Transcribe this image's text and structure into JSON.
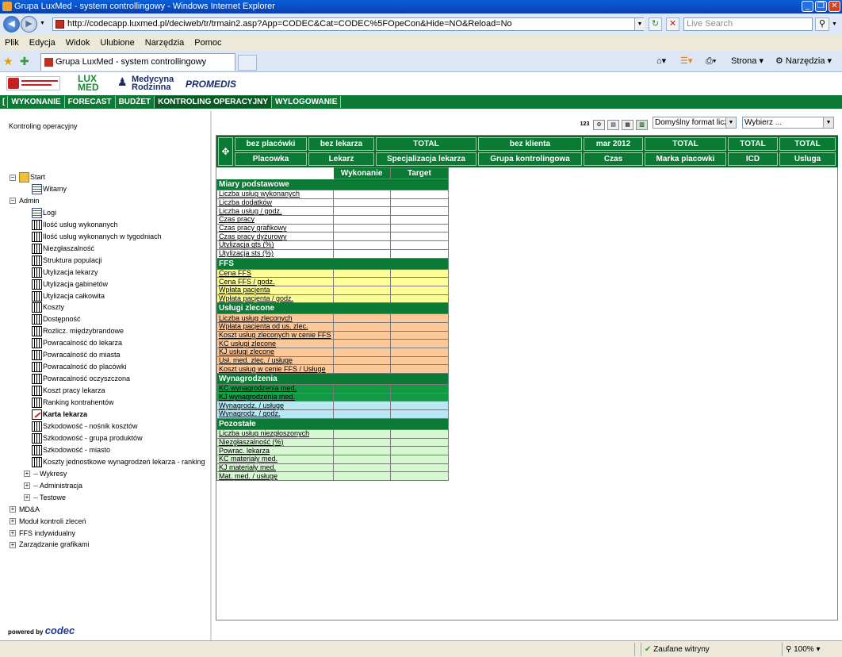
{
  "window": {
    "title": "Grupa LuxMed - system controllingowy - Windows Internet Explorer",
    "address": "http://codecapp.luxmed.pl/deciweb/tr/trmain2.asp?App=CODEC&Cat=CODEC%5FOpeCon&Hide=NO&Reload=No",
    "search_placeholder": "Live Search",
    "tab_title": "Grupa LuxMed - system controllingowy",
    "tools": {
      "strona": "Strona",
      "narzedzia": "Narzędzia"
    }
  },
  "menu": [
    "Plik",
    "Edycja",
    "Widok",
    "Ulubione",
    "Narzędzia",
    "Pomoc"
  ],
  "logos": {
    "lux": "LUX",
    "med": "MED",
    "medycyna": "Medycyna",
    "rodzinna": "Rodzinna",
    "promedis": "PROMEDIS"
  },
  "nav": [
    "WYKONANIE",
    "FORECAST",
    "BUDŻET",
    "KONTROLING OPERACYJNY",
    "WYLOGOWANIE"
  ],
  "sidebar": {
    "title": "Kontroling operacyjny",
    "items": [
      {
        "label": "Start",
        "level": 1,
        "icon": "folder",
        "toggle": "-"
      },
      {
        "label": "Witamy",
        "level": 2,
        "icon": "doc"
      },
      {
        "label": "Admin",
        "level": 1,
        "icon": "none",
        "toggle": "-"
      },
      {
        "label": "Logi",
        "level": 2,
        "icon": "doc"
      },
      {
        "label": "Ilość usług wykonanych",
        "level": 2,
        "icon": "tbl"
      },
      {
        "label": "Ilość usług wykonanych w tygodniach",
        "level": 2,
        "icon": "tbl"
      },
      {
        "label": "Niezgłaszalność",
        "level": 2,
        "icon": "tbl"
      },
      {
        "label": "Struktura populacji",
        "level": 2,
        "icon": "tbl"
      },
      {
        "label": "Utylizacja lekarzy",
        "level": 2,
        "icon": "tbl"
      },
      {
        "label": "Utylizacja gabinetów",
        "level": 2,
        "icon": "tbl"
      },
      {
        "label": "Utylizacja całkowita",
        "level": 2,
        "icon": "tbl"
      },
      {
        "label": "Koszty",
        "level": 2,
        "icon": "tbl"
      },
      {
        "label": "Dostępność",
        "level": 2,
        "icon": "tbl"
      },
      {
        "label": "Rozlicz. międzybrandowe",
        "level": 2,
        "icon": "tbl"
      },
      {
        "label": "Powracalność do lekarza",
        "level": 2,
        "icon": "tbl"
      },
      {
        "label": "Powracalność do miasta",
        "level": 2,
        "icon": "tbl"
      },
      {
        "label": "Powracalność do placówki",
        "level": 2,
        "icon": "tbl"
      },
      {
        "label": "Powracalność oczyszczona",
        "level": 2,
        "icon": "tbl"
      },
      {
        "label": "Koszt pracy lekarza",
        "level": 2,
        "icon": "tbl"
      },
      {
        "label": "Ranking kontrahentów",
        "level": 2,
        "icon": "tbl"
      },
      {
        "label": "Karta lekarza",
        "level": 2,
        "icon": "card",
        "bold": true
      },
      {
        "label": "Szkodowość - nośnik kosztów",
        "level": 2,
        "icon": "tbl"
      },
      {
        "label": "Szkodowość - grupa produktów",
        "level": 2,
        "icon": "tbl"
      },
      {
        "label": "Szkodowość - miasto",
        "level": 2,
        "icon": "tbl"
      },
      {
        "label": "Koszty jednostkowe wynagrodzeń lekarza - ranking",
        "level": 2,
        "icon": "tbl"
      },
      {
        "label": "Wykresy",
        "level": 2,
        "icon": "none",
        "toggle": "+"
      },
      {
        "label": "Administracja",
        "level": 2,
        "icon": "none",
        "toggle": "+"
      },
      {
        "label": "Testowe",
        "level": 2,
        "icon": "none",
        "toggle": "+"
      },
      {
        "label": "MD&A",
        "level": 0,
        "icon": "none",
        "toggle": "+"
      },
      {
        "label": "Moduł kontroli zleceń",
        "level": 0,
        "icon": "none",
        "toggle": "+"
      },
      {
        "label": "FFS indywidualny",
        "level": 0,
        "icon": "none",
        "toggle": "+"
      },
      {
        "label": "Zarządzanie grafikami",
        "level": 0,
        "icon": "none",
        "toggle": "+"
      }
    ],
    "powered_by": "powered by",
    "codec": "codec"
  },
  "toolbar": {
    "num_icon": "123",
    "format_select": "Domyślny format liczb",
    "choose_select": "Wybierz ..."
  },
  "dimensions": {
    "row1": [
      "bez placówki",
      "bez lekarza",
      "TOTAL",
      "bez klienta",
      "mar 2012",
      "TOTAL",
      "TOTAL",
      "TOTAL"
    ],
    "row2": [
      "Placowka",
      "Lekarz",
      "Specjalizacja lekarza",
      "Grupa kontrolingowa",
      "Czas",
      "Marka placowki",
      "ICD",
      "Usluga"
    ]
  },
  "grid": {
    "columns": [
      "Wykonanie",
      "Target"
    ],
    "rows": [
      {
        "type": "sect",
        "label": "Miary podstawowe"
      },
      {
        "type": "white",
        "label": "Liczba usług wykonanych"
      },
      {
        "type": "white",
        "label": "Liczba dodatków"
      },
      {
        "type": "white",
        "label": "Liczba usług / godz."
      },
      {
        "type": "white",
        "label": "Czas pracy"
      },
      {
        "type": "white",
        "label": "Czas pracy grafikowy"
      },
      {
        "type": "white",
        "label": "Czas pracy dyżurowy"
      },
      {
        "type": "white",
        "label": "Utylizacja gts (%)"
      },
      {
        "type": "white",
        "label": "Utylizacja sts (%)"
      },
      {
        "type": "sect",
        "label": "FFS"
      },
      {
        "type": "yellow",
        "label": "Cena FFS"
      },
      {
        "type": "yellow",
        "label": "Cena FFS / godz."
      },
      {
        "type": "yellow",
        "label": "Wpłata pacjenta"
      },
      {
        "type": "yellow",
        "label": "Wpłata pacjenta / godz."
      },
      {
        "type": "sect",
        "label": "Usługi zlecone"
      },
      {
        "type": "orange",
        "label": "Liczba usług zleconych"
      },
      {
        "type": "orange",
        "label": "Wpłata pacjenta od us. zlec."
      },
      {
        "type": "orange",
        "label": "Koszt usług zleconych w cenie FFS"
      },
      {
        "type": "orange",
        "label": "KC usługi zlecone"
      },
      {
        "type": "orange",
        "label": "KJ usługi zlecone"
      },
      {
        "type": "orange",
        "label": "Usł. med. zlec. / usługę"
      },
      {
        "type": "orange",
        "label": "Koszt usług w cenie FFS / Usługe"
      },
      {
        "type": "sect",
        "label": "Wynagrodzenia"
      },
      {
        "type": "green",
        "label": "KC wynagrodzenia med."
      },
      {
        "type": "green",
        "label": "KJ wynagrodzenia med."
      },
      {
        "type": "blue",
        "label": "Wynagrodz. / usługę"
      },
      {
        "type": "blue",
        "label": "Wynagrodz. / godz."
      },
      {
        "type": "sect",
        "label": "Pozostałe"
      },
      {
        "type": "lgreen",
        "label": "Liczba usług niezgłoszonych"
      },
      {
        "type": "lgreen",
        "label": "Niezgłaszalność (%)"
      },
      {
        "type": "lgreen",
        "label": "Powrac. lekarza"
      },
      {
        "type": "lgreen",
        "label": "KC materiały med."
      },
      {
        "type": "lgreen",
        "label": "KJ materiały med."
      },
      {
        "type": "lgreen",
        "label": "Mat. med. / usługę"
      }
    ]
  },
  "status": {
    "trusted": "Zaufane witryny",
    "zoom": "100%"
  }
}
